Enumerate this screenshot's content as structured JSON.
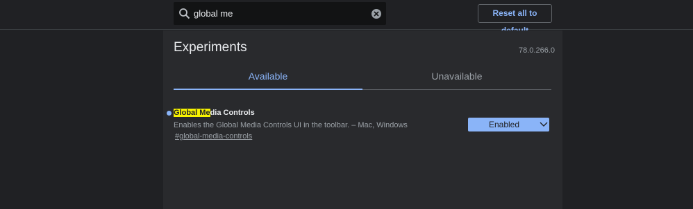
{
  "search": {
    "value": "global me",
    "icon": "search-icon",
    "clear_icon": "clear-icon"
  },
  "header": {
    "reset_label": "Reset all to default"
  },
  "page": {
    "title": "Experiments",
    "version": "78.0.266.0"
  },
  "tabs": [
    {
      "label": "Available",
      "selected": true
    },
    {
      "label": "Unavailable",
      "selected": false
    }
  ],
  "experiments": [
    {
      "name_highlight": "Global Me",
      "name_rest": "dia Controls",
      "description": "Enables the Global Media Controls UI in the toolbar. – Mac, Windows",
      "link": "#global-media-controls",
      "state": "Enabled"
    }
  ],
  "colors": {
    "accent": "#8ab4f8",
    "highlight": "#f7f300",
    "background": "#202124",
    "panel": "#292a2d"
  }
}
